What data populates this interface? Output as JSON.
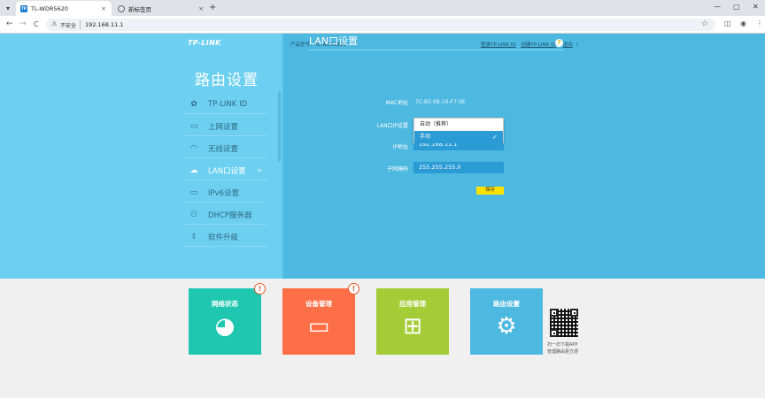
{
  "browser": {
    "tabs": [
      {
        "label": "TL-WDR5620",
        "favicon": "tp-link-favicon",
        "active": true
      },
      {
        "label": "新标签页",
        "favicon": "globe-icon",
        "active": false
      }
    ],
    "new_tab": "+",
    "tab_close": "×",
    "tab_menu": "▾",
    "window_controls": {
      "minimize": "—",
      "maximize": "▢",
      "close": "✕"
    },
    "nav": {
      "back": "←",
      "forward": "→",
      "reload": "C"
    },
    "security_label": "不安全",
    "url": "192.168.11.1"
  },
  "router": {
    "logo": "TP-LINK",
    "panel_title": "路由设置",
    "product_model": "产品型号：TL-WDR5620",
    "links": {
      "login_id": "登录TP-LINK ID",
      "create_id": "创建TP-LINK ID",
      "logout": "退出"
    },
    "menu": [
      {
        "label": "TP-LINK ID",
        "icon": "gear-icon",
        "glyph": "✿",
        "active": false
      },
      {
        "label": "上网设置",
        "icon": "laptop-icon",
        "glyph": "▭",
        "active": false
      },
      {
        "label": "无线设置",
        "icon": "wifi-icon",
        "glyph": "◠",
        "active": false
      },
      {
        "label": "LAN口设置",
        "icon": "cloud-icon",
        "glyph": "☁",
        "active": true,
        "arrow": ">"
      },
      {
        "label": "IPv6设置",
        "icon": "laptop-icon",
        "glyph": "▭",
        "active": false
      },
      {
        "label": "DHCP服务器",
        "icon": "network-icon",
        "glyph": "⚇",
        "active": false
      },
      {
        "label": "软件升级",
        "icon": "upload-icon",
        "glyph": "⇪",
        "active": false
      }
    ],
    "lan": {
      "title": "LAN口设置",
      "help": "?",
      "mac_label": "MAC地址",
      "mac_value": "7C-B5-98-10-F7-0E",
      "ip_mode_label": "LAN口IP设置",
      "ip_mode_options": [
        "自动（推荐）",
        "手动"
      ],
      "ip_mode_selected": "手动",
      "ip_label": "IP地址",
      "ip_value": "192.168.11.1",
      "mask_label": "子网掩码",
      "mask_value": "255.255.255.0",
      "save": "保存"
    }
  },
  "tiles": [
    {
      "label": "网络状态",
      "icon": "globe-chat-icon",
      "glyph": "◕",
      "color": "#1fc7b0",
      "badge": "!"
    },
    {
      "label": "设备管理",
      "icon": "wifi-laptop-icon",
      "glyph": "▭",
      "color": "#ff6f47",
      "badge": "!"
    },
    {
      "label": "应用管理",
      "icon": "apps-grid-icon",
      "glyph": "⊞",
      "color": "#a4cc36",
      "badge": ""
    },
    {
      "label": "路由设置",
      "icon": "settings-gear-icon",
      "glyph": "⚙",
      "color": "#4db8e0",
      "badge": ""
    }
  ],
  "qr": {
    "line1": "扫一扫下载APP",
    "line2": "管理路由更方便"
  }
}
